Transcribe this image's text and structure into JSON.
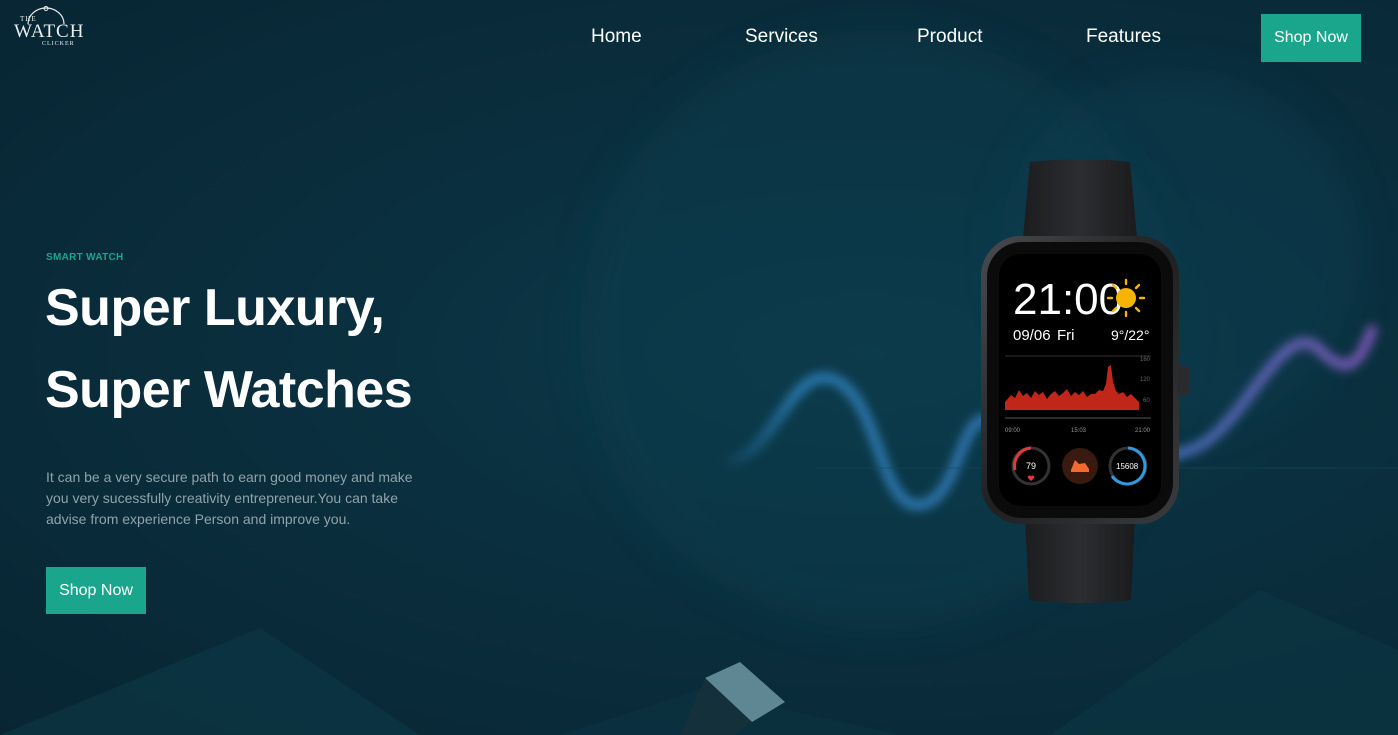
{
  "brand": {
    "logo_line1": "THE",
    "logo_line2": "WATCH",
    "logo_line3": "CLICKER"
  },
  "nav": {
    "items": [
      "Home",
      "Services",
      "Product",
      "Features"
    ],
    "cta_label": "Shop Now"
  },
  "hero": {
    "eyebrow": "SMART WATCH",
    "headline_line1": "Super Luxury,",
    "headline_line2": "Super Watches",
    "description": "It can be a very secure path to earn good money and make you very sucessfully creativity entrepreneur.You can take advise from experience Person and improve you.",
    "cta_label": "Shop Now"
  },
  "watch_face": {
    "time": "21:00",
    "date": "09/06",
    "day": "Fri",
    "temperature": "9°/22°",
    "chart_labels": [
      "09:00",
      "15:03",
      "21:00"
    ],
    "scale_labels": [
      "160",
      "120",
      "60"
    ],
    "heart_rate": "79",
    "steps": "15608"
  },
  "colors": {
    "accent": "#1aa68c",
    "background": "#0a2f3e",
    "wave_start": "#2f86c4",
    "wave_end": "#8a5cc4"
  }
}
